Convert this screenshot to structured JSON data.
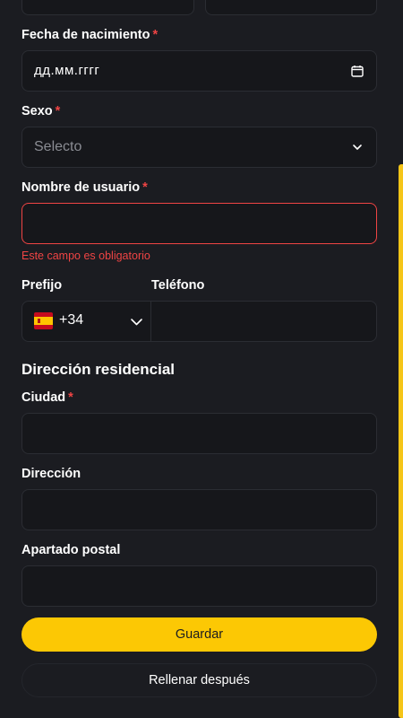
{
  "form": {
    "birthdate": {
      "label": "Fecha de nacimiento",
      "required_mark": "*",
      "placeholder": "дд.мм.гггг"
    },
    "sex": {
      "label": "Sexo",
      "required_mark": "*",
      "placeholder": "Selecto"
    },
    "username": {
      "label": "Nombre de usuario",
      "required_mark": "*",
      "value": "",
      "error": "Este campo es obligatorio"
    },
    "prefix": {
      "label": "Prefijo",
      "value": "+34",
      "flag": "spain-flag-icon"
    },
    "phone": {
      "label": "Teléfono",
      "value": ""
    },
    "residence": {
      "title": "Dirección residencial"
    },
    "city": {
      "label": "Ciudad",
      "required_mark": "*",
      "value": ""
    },
    "address": {
      "label": "Dirección",
      "value": ""
    },
    "postal": {
      "label": "Apartado postal",
      "value": ""
    }
  },
  "actions": {
    "save_label": "Guardar",
    "later_label": "Rellenar después"
  },
  "colors": {
    "background": "#1b1c21",
    "field_background": "#16171b",
    "accent": "#fcc804",
    "error": "#ef4444"
  },
  "icons": {
    "date_picker": "calendar-icon",
    "sex_dropdown": "chevron-down-icon",
    "prefix_dropdown": "chevron-down-icon"
  }
}
